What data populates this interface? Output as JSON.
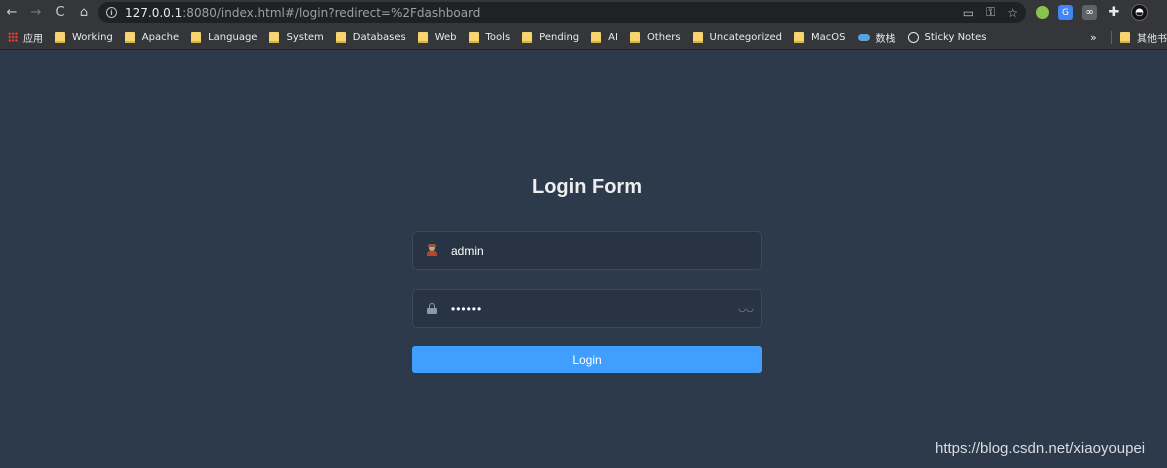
{
  "browser": {
    "url_host": "127.0.0.1",
    "url_rest": ":8080/index.html#/login?redirect=%2Fdashboard",
    "nav": {
      "back": "←",
      "forward": "→",
      "reload": "C",
      "home": "⌂"
    },
    "omni_icons": [
      "install-icon",
      "key-icon",
      "star-icon"
    ],
    "extensions": [
      "green-dot-extension",
      "translate-extension",
      "reader-extension",
      "puzzle-icon",
      "profile-avatar"
    ]
  },
  "bookmarks": {
    "apps_label": "应用",
    "items": [
      {
        "label": "Working",
        "icon": "folder-icon"
      },
      {
        "label": "Apache",
        "icon": "folder-icon"
      },
      {
        "label": "Language",
        "icon": "folder-icon"
      },
      {
        "label": "System",
        "icon": "folder-icon"
      },
      {
        "label": "Databases",
        "icon": "folder-icon"
      },
      {
        "label": "Web",
        "icon": "folder-icon"
      },
      {
        "label": "Tools",
        "icon": "folder-icon"
      },
      {
        "label": "Pending",
        "icon": "folder-icon"
      },
      {
        "label": "AI",
        "icon": "folder-icon"
      },
      {
        "label": "Others",
        "icon": "folder-icon"
      },
      {
        "label": "Uncategorized",
        "icon": "folder-icon"
      },
      {
        "label": "MacOS",
        "icon": "folder-icon"
      },
      {
        "label": "数栈",
        "icon": "cloud-icon"
      },
      {
        "label": "Sticky Notes",
        "icon": "globe-icon"
      }
    ],
    "more": "»",
    "other": "其他书"
  },
  "login": {
    "title": "Login Form",
    "username": {
      "value": "admin",
      "icon": "user-icon"
    },
    "password": {
      "value": "••••••",
      "icon": "lock-icon",
      "toggle_icon": "eye-closed-icon"
    },
    "button_label": "Login"
  },
  "watermark": "https://blog.csdn.net/xiaoyoupei",
  "colors": {
    "background": "#2d3a4b",
    "button": "#409eff",
    "title": "#eeeeee"
  }
}
